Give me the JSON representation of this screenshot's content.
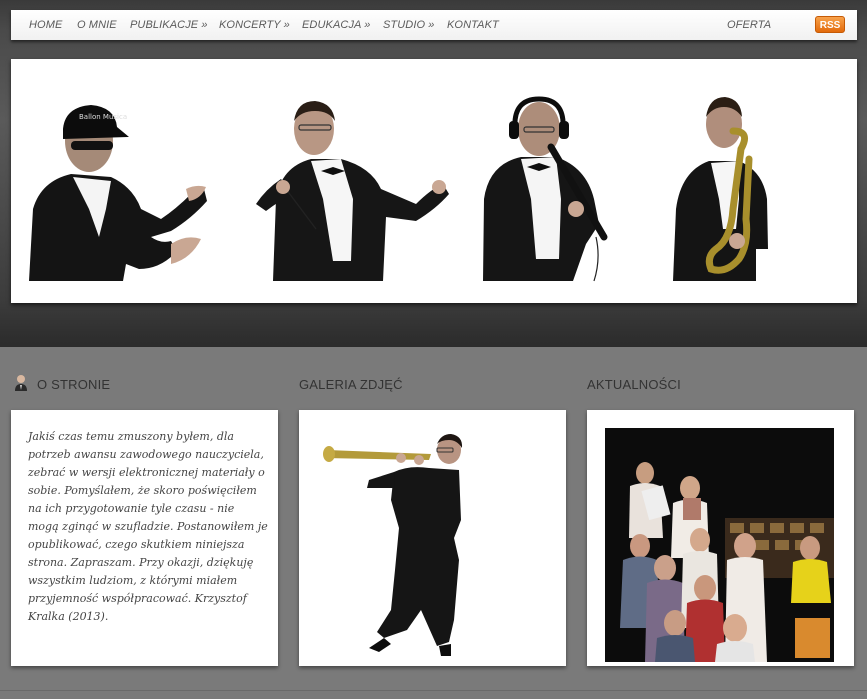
{
  "nav": {
    "items": [
      {
        "label": "HOME"
      },
      {
        "label": "O MNIE"
      },
      {
        "label": "PUBLIKACJE »"
      },
      {
        "label": "KONCERTY »"
      },
      {
        "label": "EDUKACJA »"
      },
      {
        "label": "STUDIO »"
      },
      {
        "label": "KONTAKT"
      }
    ],
    "right_label": "OFERTA",
    "rss_label": "RSS",
    "rss_color": "#e8790f"
  },
  "banner": {
    "cap_text": "Ballon Musica",
    "figures": [
      "conductor-with-cap",
      "conductor-with-baton",
      "singer-with-headphones",
      "saxophone-player"
    ]
  },
  "sections": {
    "about": {
      "heading": "O STRONIE",
      "icon": "user-icon",
      "text": "Jakiś czas temu zmuszony byłem, dla potrzeb awansu zawodowego nauczyciela, zebrać w wersji elektronicznej materiały o sobie. Pomyślałem, że skoro poświęciłem na ich przygotowanie tyle czasu - nie mogą zginąć w szufladzie. Postanowiłem je opublikować, czego skutkiem niniejsza strona. Zapraszam. Przy okazji, dziękuję wszystkim ludziom, z którymi miałem przyjemność współpracować. Krzysztof Kralka (2013)."
    },
    "gallery": {
      "heading": "GALERIA ZDJĘĆ",
      "image": "soprano-saxophone-player"
    },
    "news": {
      "heading": "AKTUALNOŚCI",
      "image": "choir-rehearsal-audience"
    }
  },
  "colors": {
    "nav_text": "#5a5a5a",
    "background_top": "#3c3c3c",
    "background_bottom": "#7a7a7a",
    "heading_text": "#333333"
  }
}
